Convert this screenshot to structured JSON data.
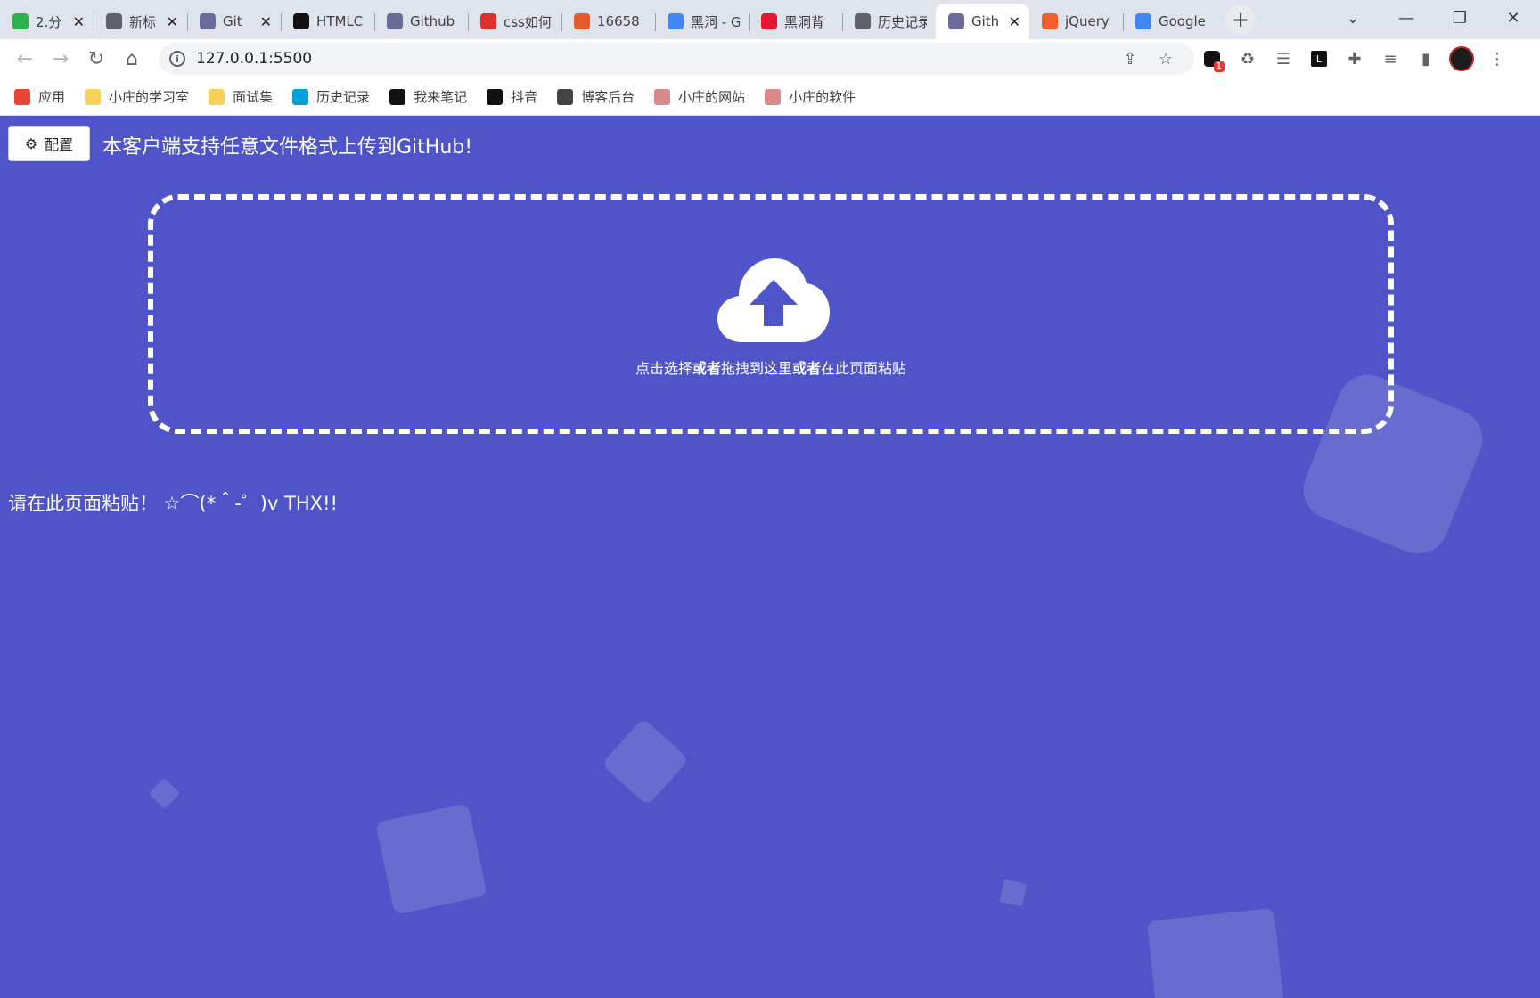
{
  "browser": {
    "tabs": [
      {
        "title": "2.分",
        "favicon": "shopping-bag-icon",
        "color": "#2bb34b",
        "closable": true
      },
      {
        "title": "新标",
        "favicon": "chrome-icon",
        "color": "#5f6368",
        "closable": true
      },
      {
        "title": "Git",
        "favicon": "github-cat-icon",
        "color": "#6b6b9a",
        "closable": true
      },
      {
        "title": "HTMLC",
        "favicon": "m-logo-icon",
        "color": "#111111",
        "closable": false
      },
      {
        "title": "Github",
        "favicon": "github-cat-icon",
        "color": "#6b6b9a",
        "closable": false
      },
      {
        "title": "css如何",
        "favicon": "html-badge-icon",
        "color": "#e0302b",
        "closable": false
      },
      {
        "title": "16658",
        "favicon": "shield-icon",
        "color": "#e55a2b",
        "closable": false
      },
      {
        "title": "黑洞 - G",
        "favicon": "google-icon",
        "color": "#4285f4",
        "closable": false
      },
      {
        "title": "黑洞背",
        "favicon": "weibo-icon",
        "color": "#e6162d",
        "closable": false
      },
      {
        "title": "历史记录",
        "favicon": "history-icon",
        "color": "#5f6368",
        "closable": false
      },
      {
        "title": "Gith",
        "favicon": "github-cat-icon",
        "color": "#6b6b9a",
        "closable": true,
        "active": true
      },
      {
        "title": "jQuery",
        "favicon": "c-logo-icon",
        "color": "#f25c2a",
        "closable": false
      },
      {
        "title": "Google",
        "favicon": "google-translate-icon",
        "color": "#4285f4",
        "closable": false
      }
    ],
    "url": "127.0.0.1:5500",
    "extension_badge": "1",
    "bookmarks": [
      {
        "label": "应用",
        "icon": "apps-grid-icon",
        "color": "#ea4335"
      },
      {
        "label": "小庄的学习室",
        "icon": "folder-icon",
        "color": "#f7d154"
      },
      {
        "label": "面试集",
        "icon": "folder-icon",
        "color": "#f7d154"
      },
      {
        "label": "历史记录",
        "icon": "bilibili-icon",
        "color": "#00a1d6"
      },
      {
        "label": "我来笔记",
        "icon": "note-icon",
        "color": "#111111"
      },
      {
        "label": "抖音",
        "icon": "tiktok-icon",
        "color": "#111111"
      },
      {
        "label": "博客后台",
        "icon": "feather-icon",
        "color": "#444444"
      },
      {
        "label": "小庄的网站",
        "icon": "pig-icon",
        "color": "#d98b8b"
      },
      {
        "label": "小庄的软件",
        "icon": "pig-icon",
        "color": "#d98b8b"
      }
    ]
  },
  "page": {
    "config_label": "配置",
    "header": "本客户端支持任意文件格式上传到GitHub!",
    "drop_text": {
      "part1": "点击选择",
      "or1": "或者",
      "part2": "拖拽到这里",
      "or2": "或者",
      "part3": "在此页面粘贴"
    },
    "paste_message": "请在此页面粘贴！ ☆⌒(*＾-゜)v THX!!",
    "colors": {
      "background": "#4f54c8",
      "accent": "#ffffff"
    }
  }
}
